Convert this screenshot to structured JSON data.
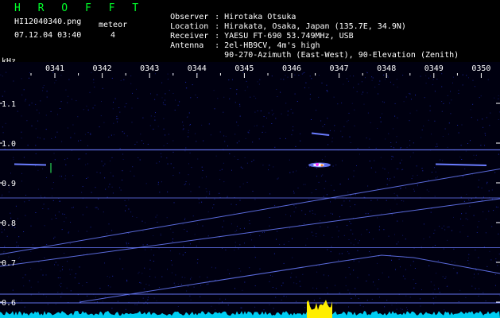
{
  "header": {
    "brand": "H R O F F T",
    "filename": "HI12040340.png",
    "datetime": "07.12.04 03:40",
    "meteor_label": "meteor",
    "meteor_count": "4"
  },
  "station": {
    "rows": [
      {
        "key": "Observer",
        "value": "Hirotaka Otsuka"
      },
      {
        "key": "Location",
        "value": "Hirakata, Osaka, Japan (135.7E, 34.9N)"
      },
      {
        "key": "Receiver",
        "value": "YAESU FT-690 53.749MHz, USB"
      },
      {
        "key": "Antenna",
        "value": "2el-HB9CV, 4m's high"
      },
      {
        "key": "",
        "value": "90-270-Azimuth (East-West), 90-Elevation (Zenith)"
      }
    ],
    "separator": ":"
  },
  "spectrogram": {
    "unit": "kHz",
    "time_ticks": [
      "0341",
      "0342",
      "0343",
      "0344",
      "0345",
      "0346",
      "0347",
      "0348",
      "0349",
      "0350"
    ],
    "freq_ticks": [
      "1.1",
      "1.0",
      "0.9",
      "0.8",
      "0.7",
      "0.6"
    ],
    "colors": {
      "background": "#000010",
      "noise": "#1f2dc0",
      "signal": "#6a7cff",
      "hot": "#ffffff",
      "meteor_core": "#ff3aff",
      "amplitude": "#00d8ff",
      "burst": "#ffee00",
      "tick": "#ffffff",
      "brand": "#00ff2a"
    }
  }
}
